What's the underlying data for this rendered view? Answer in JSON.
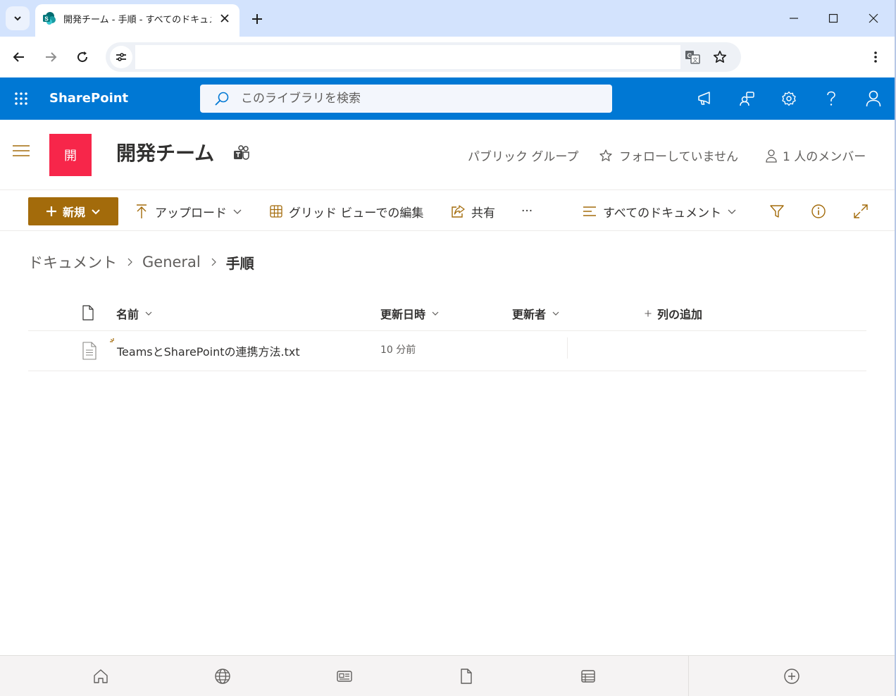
{
  "browser": {
    "tab_title": "開発チーム - 手順 - すべてのドキュメント",
    "omnibox_value": ""
  },
  "suitebar": {
    "brand": "SharePoint",
    "search_placeholder": "このライブラリを検索",
    "accent": "#0078d4"
  },
  "site": {
    "logo_letter": "開",
    "logo_color": "#f7264a",
    "title": "開発チーム",
    "group_type": "パブリック グループ",
    "follow_label": "フォローしていません",
    "members_label": "1 人のメンバー"
  },
  "commands": {
    "new_label": "新規",
    "new_color": "#a36b0b",
    "upload_label": "アップロード",
    "grid_label": "グリッド ビューでの編集",
    "share_label": "共有",
    "more_label": "···",
    "view_label": "すべてのドキュメント"
  },
  "breadcrumb": {
    "items": [
      "ドキュメント",
      "General"
    ],
    "current": "手順"
  },
  "list": {
    "columns": {
      "name": "名前",
      "modified": "更新日時",
      "modified_by": "更新者",
      "add_column": "列の追加"
    },
    "rows": [
      {
        "name": "TeamsとSharePointの連携方法.txt",
        "modified": "10 分前",
        "modified_by": ""
      }
    ]
  },
  "icons": {
    "bottom": [
      "home-icon",
      "globe-icon",
      "news-icon",
      "file-icon",
      "list-icon",
      "add-circle-icon"
    ]
  }
}
